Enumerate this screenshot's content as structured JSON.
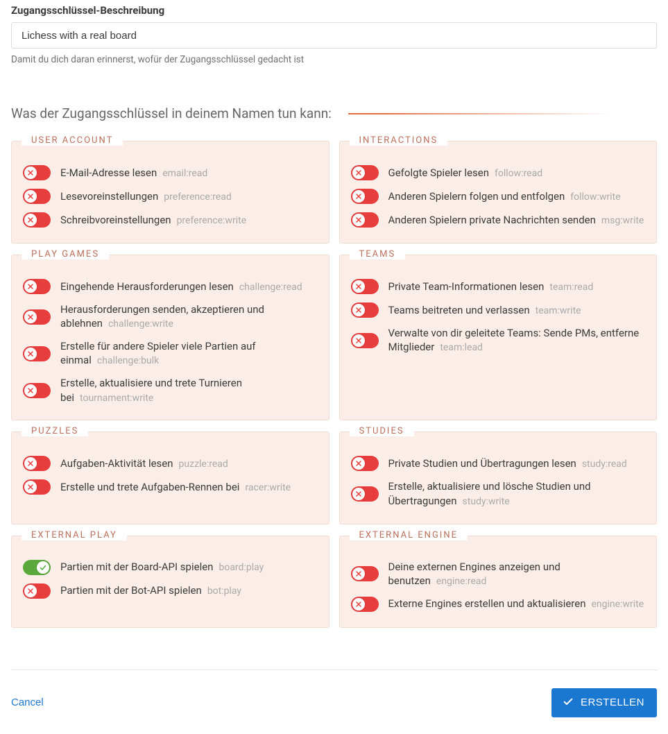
{
  "form": {
    "description_label": "Zugangsschlüssel-Beschreibung",
    "description_value": "Lichess with a real board",
    "description_hint": "Damit du dich daran erinnerst, wofür der Zugangsschlüssel gedacht ist",
    "scopes_heading": "Was der Zugangsschlüssel in deinem Namen tun kann:"
  },
  "panels": [
    {
      "id": "user-account",
      "title": "USER ACCOUNT",
      "scopes": [
        {
          "name": "email-read",
          "label": "E-Mail-Adresse lesen",
          "code": "email:read",
          "on": false
        },
        {
          "name": "preference-read",
          "label": "Lesevoreinstellungen",
          "code": "preference:read",
          "on": false
        },
        {
          "name": "preference-write",
          "label": "Schreibvoreinstellungen",
          "code": "preference:write",
          "on": false
        }
      ]
    },
    {
      "id": "interactions",
      "title": "INTERACTIONS",
      "scopes": [
        {
          "name": "follow-read",
          "label": "Gefolgte Spieler lesen",
          "code": "follow:read",
          "on": false
        },
        {
          "name": "follow-write",
          "label": "Anderen Spielern folgen und entfolgen",
          "code": "follow:write",
          "on": false
        },
        {
          "name": "msg-write",
          "label": "Anderen Spielern private Nachrichten senden",
          "code": "msg:write",
          "on": false
        }
      ]
    },
    {
      "id": "play-games",
      "title": "PLAY GAMES",
      "scopes": [
        {
          "name": "challenge-read",
          "label": "Eingehende Herausforderungen lesen",
          "code": "challenge:read",
          "on": false
        },
        {
          "name": "challenge-write",
          "label": "Herausforderungen senden, akzeptieren und ablehnen",
          "code": "challenge:write",
          "on": false
        },
        {
          "name": "challenge-bulk",
          "label": "Erstelle für andere Spieler viele Partien auf einmal",
          "code": "challenge:bulk",
          "on": false
        },
        {
          "name": "tournament-write",
          "label": "Erstelle, aktualisiere und trete Turnieren bei",
          "code": "tournament:write",
          "on": false
        }
      ]
    },
    {
      "id": "teams",
      "title": "TEAMS",
      "scopes": [
        {
          "name": "team-read",
          "label": "Private Team-Informationen lesen",
          "code": "team:read",
          "on": false
        },
        {
          "name": "team-write",
          "label": "Teams beitreten und verlassen",
          "code": "team:write",
          "on": false
        },
        {
          "name": "team-lead",
          "label": "Verwalte von dir geleitete Teams: Sende PMs, entferne Mitglieder",
          "code": "team:lead",
          "on": false
        }
      ]
    },
    {
      "id": "puzzles",
      "title": "PUZZLES",
      "scopes": [
        {
          "name": "puzzle-read",
          "label": "Aufgaben-Aktivität lesen",
          "code": "puzzle:read",
          "on": false
        },
        {
          "name": "racer-write",
          "label": "Erstelle und trete Aufgaben-Rennen bei",
          "code": "racer:write",
          "on": false
        }
      ]
    },
    {
      "id": "studies",
      "title": "STUDIES",
      "scopes": [
        {
          "name": "study-read",
          "label": "Private Studien und Übertragungen lesen",
          "code": "study:read",
          "on": false
        },
        {
          "name": "study-write",
          "label": "Erstelle, aktualisiere und lösche Studien und Übertragungen",
          "code": "study:write",
          "on": false
        }
      ]
    },
    {
      "id": "external-play",
      "title": "EXTERNAL PLAY",
      "scopes": [
        {
          "name": "board-play",
          "label": "Partien mit der Board-API spielen",
          "code": "board:play",
          "on": true
        },
        {
          "name": "bot-play",
          "label": "Partien mit der Bot-API spielen",
          "code": "bot:play",
          "on": false
        }
      ]
    },
    {
      "id": "external-engine",
      "title": "EXTERNAL ENGINE",
      "scopes": [
        {
          "name": "engine-read",
          "label": "Deine externen Engines anzeigen und benutzen",
          "code": "engine:read",
          "on": false
        },
        {
          "name": "engine-write",
          "label": "Externe Engines erstellen und aktualisieren",
          "code": "engine:write",
          "on": false
        }
      ]
    }
  ],
  "footer": {
    "cancel": "Cancel",
    "submit": "ERSTELLEN"
  }
}
